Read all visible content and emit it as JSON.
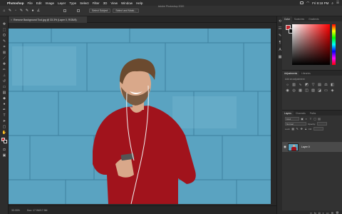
{
  "menubar": {
    "app_name": "Photoshop",
    "items": [
      "File",
      "Edit",
      "Image",
      "Layer",
      "Type",
      "Select",
      "Filter",
      "3D",
      "View",
      "Window",
      "Help"
    ],
    "clock": "Fri 9:18 PM"
  },
  "window_title": "Adobe Photoshop 2020",
  "options": {
    "select_subject": "Select Subject",
    "select_and_mask": "Select and Mask..."
  },
  "document": {
    "tab_label": "Remove Background Tool.jpg @ 33.3% (Layer 0, RGB/8)"
  },
  "status": {
    "zoom": "33.33%",
    "doc_size": "Doc: 17.9M/17.9M"
  },
  "panels": {
    "color_tabs": [
      "Color",
      "Swatches",
      "Gradients"
    ],
    "adjust_tabs": [
      "Adjustments",
      "Libraries"
    ],
    "adjust_label": "Add an adjustment",
    "layers_tabs": [
      "Layers",
      "Channels",
      "Paths"
    ],
    "kind_label": "Kind",
    "blend_label": "Normal",
    "opacity_label": "Opacity:",
    "lock_label": "Lock:",
    "fill_label": "Fill:",
    "layer_name": "Layer 0"
  },
  "colors": {
    "foreground": "#c4242b",
    "background": "#111111",
    "wall": "#5aa3c1",
    "sweater": "#a1131c"
  }
}
